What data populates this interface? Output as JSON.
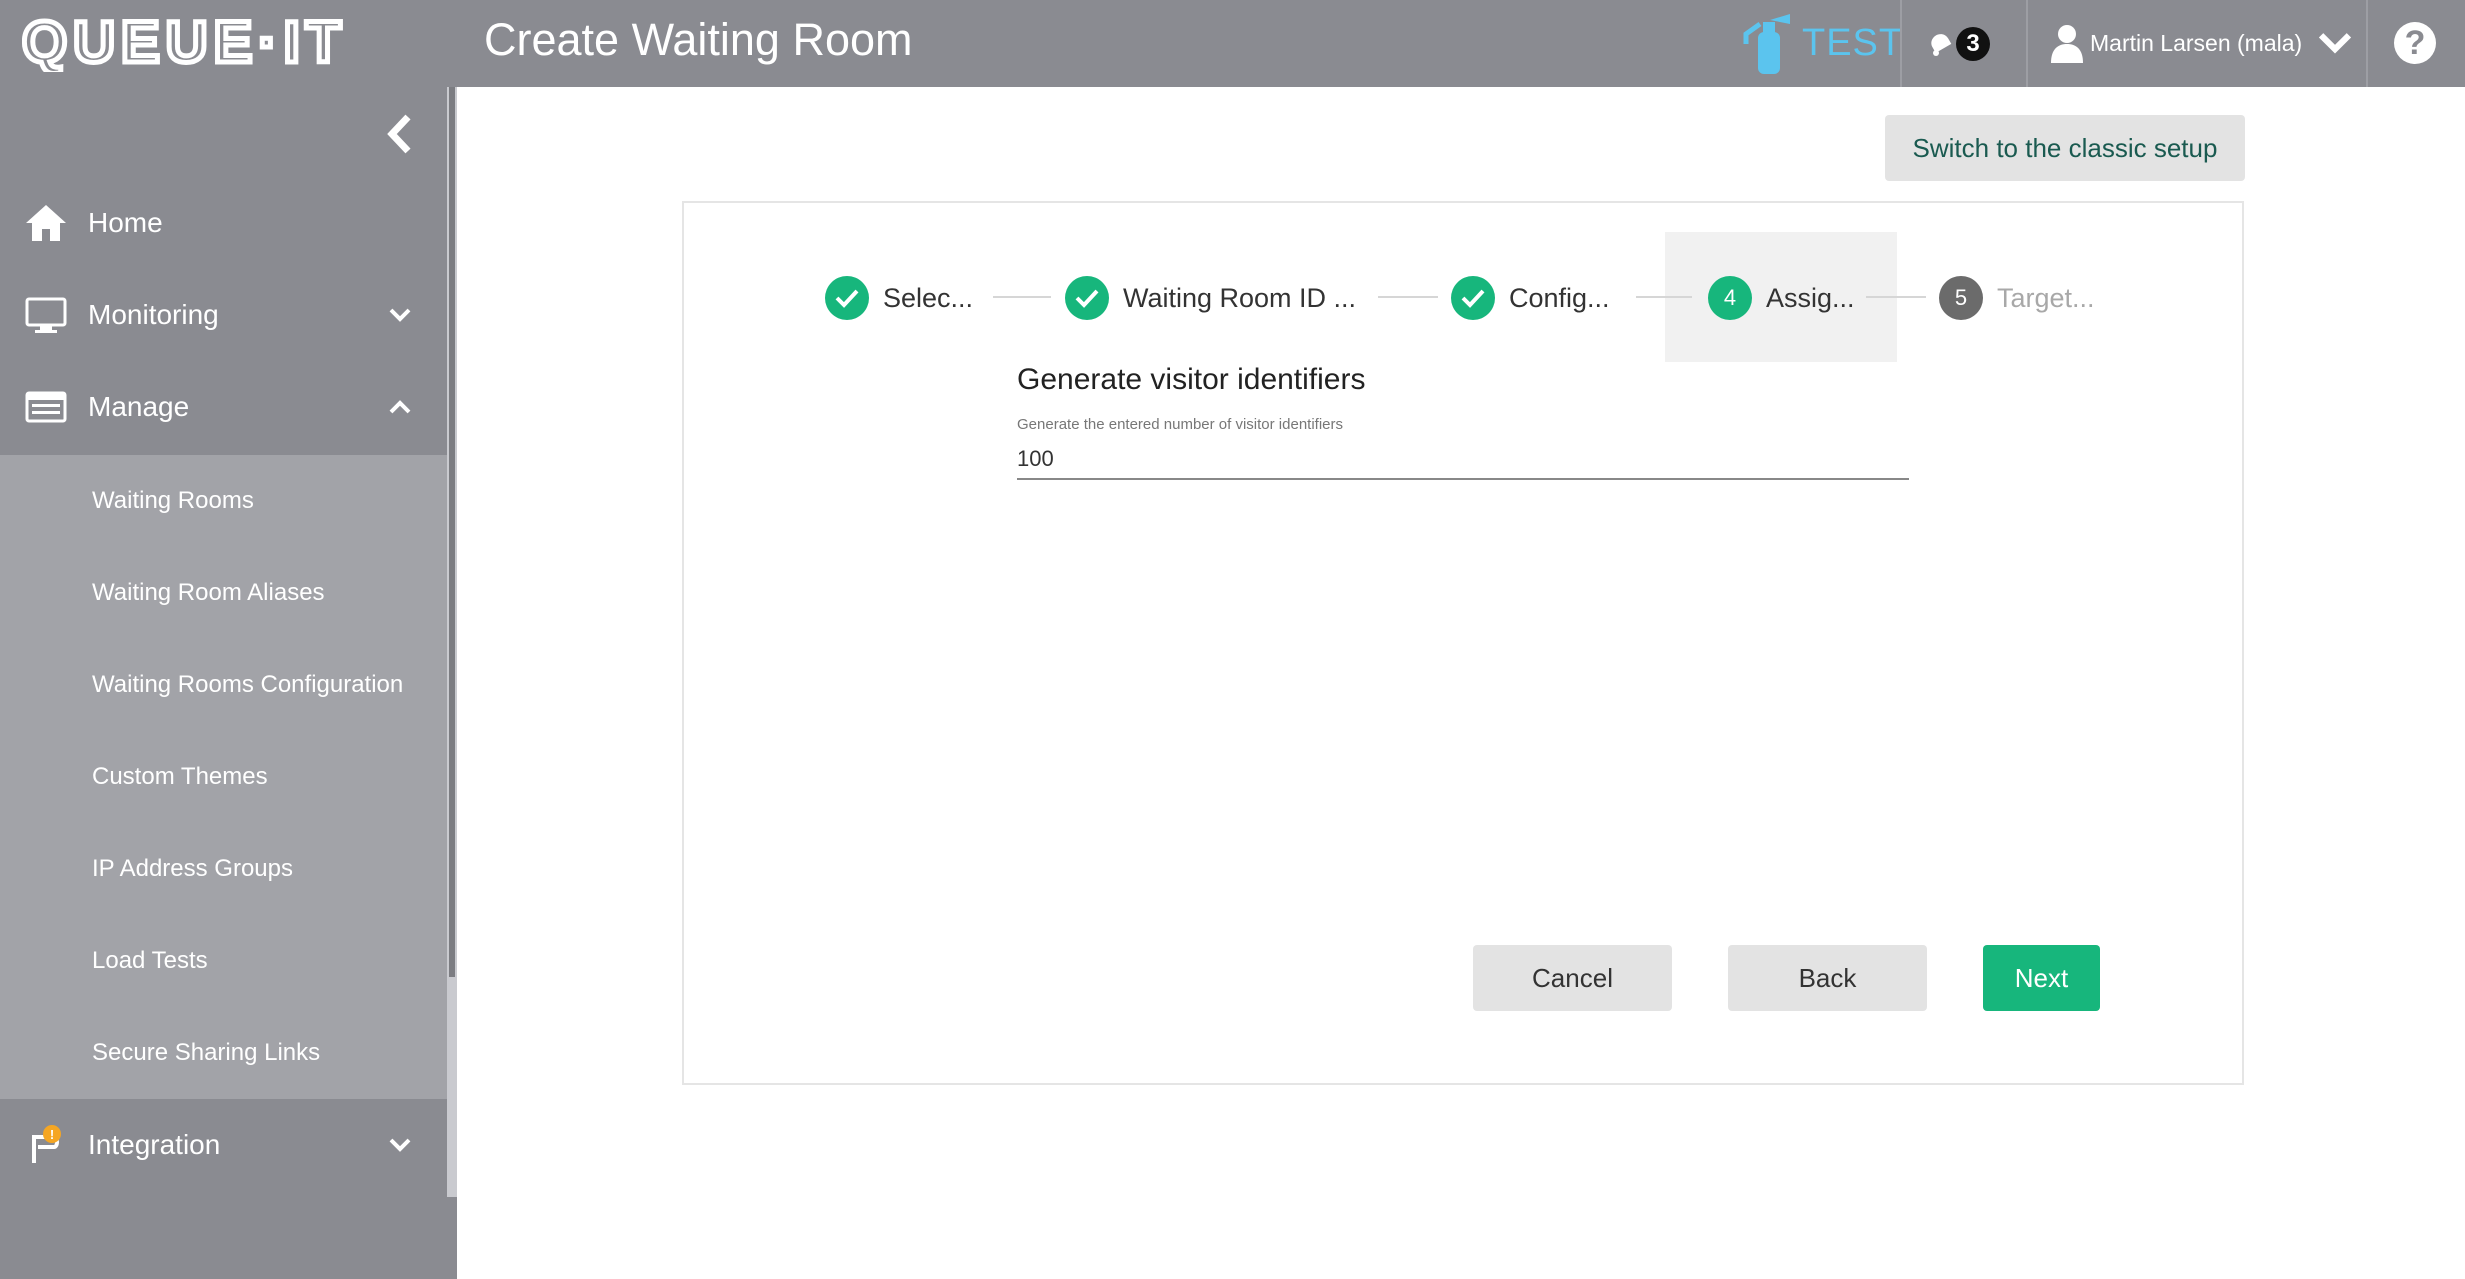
{
  "header": {
    "logo_text": "QUEUE·IT",
    "title": "Create Waiting Room",
    "environment": "TEST",
    "notification_count": "3",
    "user_name": "Martin Larsen (mala)",
    "help_symbol": "?"
  },
  "sidebar": {
    "items": [
      {
        "label": "Home",
        "icon": "home-icon"
      },
      {
        "label": "Monitoring",
        "icon": "monitor-icon",
        "expanded": false
      },
      {
        "label": "Manage",
        "icon": "manage-icon",
        "expanded": true
      },
      {
        "label": "Integration",
        "icon": "integration-icon",
        "expanded": false,
        "badge": "!"
      }
    ],
    "manage_subitems": [
      "Waiting Rooms",
      "Waiting Room Aliases",
      "Waiting Rooms Configuration",
      "Custom Themes",
      "IP Address Groups",
      "Load Tests",
      "Secure Sharing Links"
    ]
  },
  "main": {
    "classic_setup_label": "Switch to the classic setup",
    "steps": [
      {
        "label": "Selec...",
        "status": "done"
      },
      {
        "label": "Waiting Room ID ...",
        "status": "done"
      },
      {
        "label": "Config...",
        "status": "done"
      },
      {
        "number": "4",
        "label": "Assig...",
        "status": "active"
      },
      {
        "number": "5",
        "label": "Target...",
        "status": "pending"
      }
    ],
    "section_title": "Generate visitor identifiers",
    "field_label": "Generate the entered number of visitor identifiers",
    "field_value": "100",
    "buttons": {
      "cancel": "Cancel",
      "back": "Back",
      "next": "Next"
    }
  },
  "colors": {
    "topbar": "#8a8b91",
    "sidebar": "#8a8b91",
    "submenu": "#a2a3a8",
    "accent_green": "#17b67c",
    "env_blue": "#5bc4ee"
  }
}
